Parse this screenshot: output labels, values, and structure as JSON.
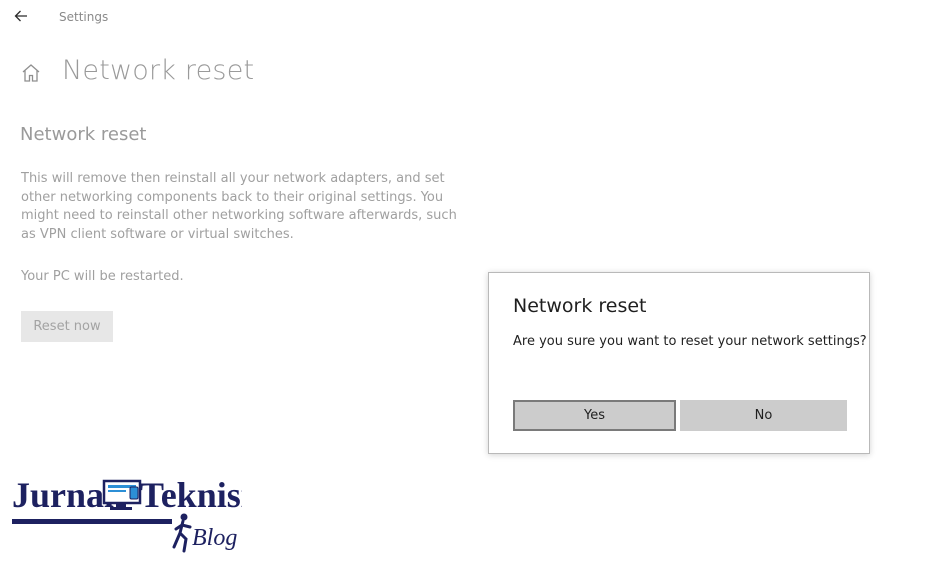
{
  "window": {
    "app_title": "Settings",
    "back_icon": "arrow-left-icon"
  },
  "header": {
    "home_icon": "home-icon",
    "page_title": "Network reset"
  },
  "content": {
    "section_title": "Network reset",
    "description": "This will remove then reinstall all your network adapters, and set other networking components back to their original settings. You might need to reinstall other networking software afterwards, such as VPN client software or virtual switches.",
    "restart_note": "Your PC will be restarted.",
    "reset_button_label": "Reset now"
  },
  "dialog": {
    "title": "Network reset",
    "message": "Are you sure you want to reset your network settings?",
    "yes_label": "Yes",
    "no_label": "No"
  },
  "watermark": {
    "brand_part1": "Jurnal",
    "brand_part2": "Teknisi",
    "brand_sub": "Blog",
    "colors": {
      "navy": "#1d2160",
      "accent": "#2c8fd6"
    }
  },
  "colors": {
    "muted_text": "#a0a0a0",
    "dialog_button": "#cccccc",
    "dialog_focus_border": "#7a7a7a"
  }
}
